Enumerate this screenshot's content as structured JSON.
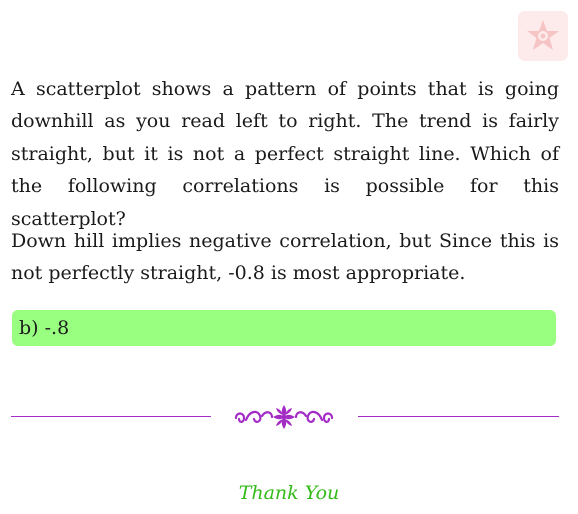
{
  "question": "A scatterplot shows a pattern of points that is going downhill as you read left to right. The trend is fairly straight, but it is not a perfect straight line. Which of the following correlations is possible for this scatterplot?",
  "explanation": "Down hill implies negative correlation, but Since this is not perfectly straight, -0.8 is most appropriate.",
  "answer": "b) -.8",
  "closing": "Thank You",
  "colors": {
    "answer_background": "#99ff80",
    "ornament": "#a32cc4",
    "closing_text": "#33bb1a",
    "logo_background": "#fdeaea"
  },
  "icons": {
    "logo": "star-flower-logo-icon",
    "divider": "floral-ornament-icon"
  }
}
